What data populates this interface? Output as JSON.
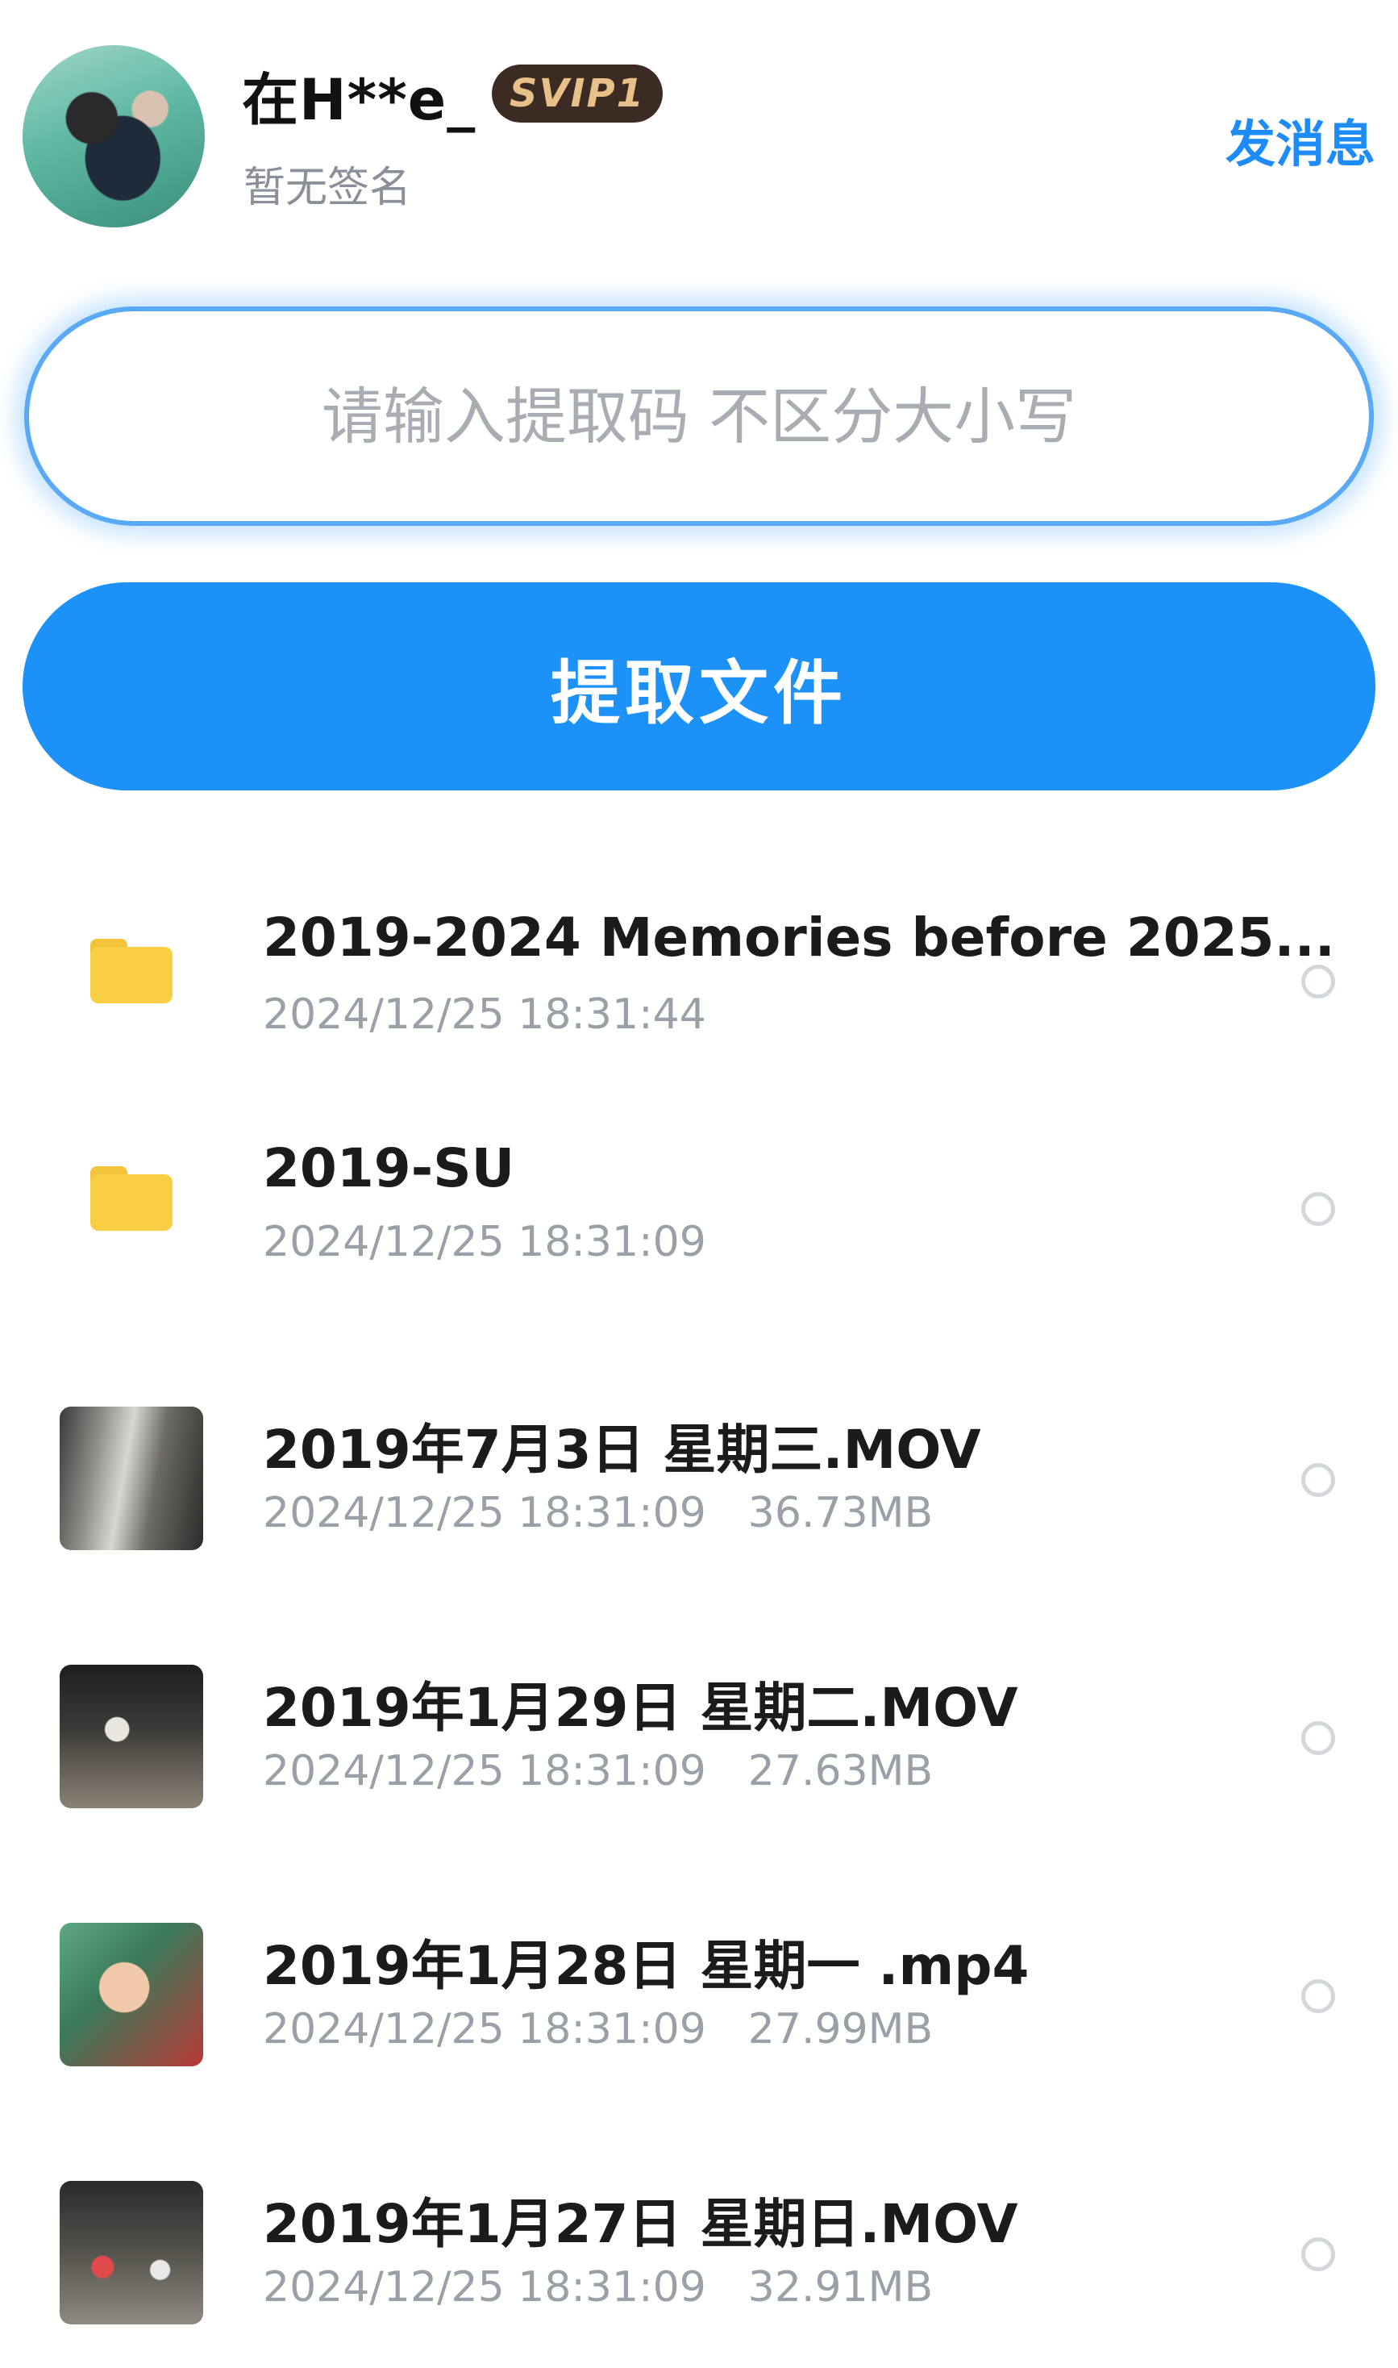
{
  "header": {
    "username": "在H**e_",
    "vip_badge": "SVIP1",
    "signature": "暂无签名",
    "send_message_label": "发消息"
  },
  "extract": {
    "placeholder": "请输入提取码 不区分大小写",
    "button_label": "提取文件"
  },
  "files": [
    {
      "type": "folder",
      "name": "2019-2024 Memories before 2025...",
      "date": "2024/12/25 18:31:44",
      "size": ""
    },
    {
      "type": "folder",
      "name": "2019-SU",
      "date": "2024/12/25 18:31:09",
      "size": ""
    },
    {
      "type": "video",
      "name": "2019年7月3日 星期三.MOV",
      "date": "2024/12/25 18:31:09",
      "size": "36.73MB"
    },
    {
      "type": "video",
      "name": "2019年1月29日 星期二.MOV",
      "date": "2024/12/25 18:31:09",
      "size": "27.63MB"
    },
    {
      "type": "video",
      "name": "2019年1月28日 星期一 .mp4",
      "date": "2024/12/25 18:31:09",
      "size": "27.99MB"
    },
    {
      "type": "video",
      "name": "2019年1月27日 星期日.MOV",
      "date": "2024/12/25 18:31:09",
      "size": "32.91MB"
    }
  ],
  "colors": {
    "accent": "#1c91f7",
    "folder": "#f8cf44",
    "vip_bg": "#3b2b22",
    "vip_text": "#e8c08a"
  }
}
